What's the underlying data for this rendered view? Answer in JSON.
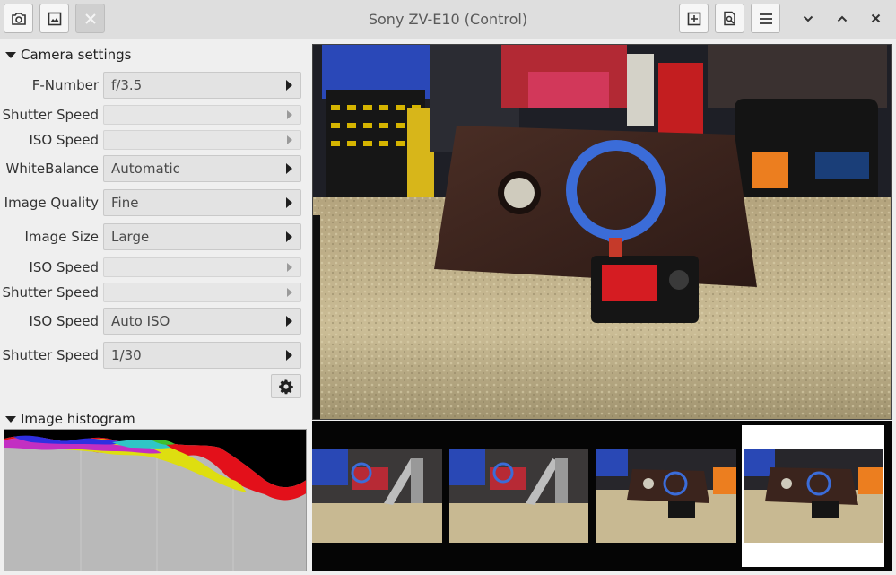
{
  "window": {
    "title": "Sony ZV-E10 (Control)",
    "toolbar_left": [
      {
        "icon": "camera-icon"
      },
      {
        "icon": "image-icon"
      },
      {
        "icon": "close-capture-icon",
        "disabled": true
      }
    ],
    "toolbar_right": [
      {
        "icon": "focus-target-icon"
      },
      {
        "icon": "zoom-document-icon"
      },
      {
        "icon": "hamburger-menu-icon"
      }
    ],
    "window_controls": [
      "minimize-icon",
      "maximize-icon",
      "close-icon"
    ]
  },
  "camera_settings": {
    "header": "Camera settings",
    "rows": [
      {
        "label": "F-Number",
        "value": "f/3.5",
        "enabled": true
      },
      {
        "label": "Shutter Speed",
        "value": "",
        "enabled": false
      },
      {
        "label": "ISO Speed",
        "value": "",
        "enabled": false
      },
      {
        "label": "WhiteBalance",
        "value": "Automatic",
        "enabled": true
      },
      {
        "label": "Image Quality",
        "value": "Fine",
        "enabled": true
      },
      {
        "label": "Image Size",
        "value": "Large",
        "enabled": true
      },
      {
        "label": "ISO Speed",
        "value": "",
        "enabled": false
      },
      {
        "label": "Shutter Speed",
        "value": "",
        "enabled": false
      },
      {
        "label": "ISO Speed",
        "value": "Auto ISO",
        "enabled": true
      },
      {
        "label": "Shutter Speed",
        "value": "1/30",
        "enabled": true
      }
    ],
    "settings_icon": "gear-icon"
  },
  "histogram": {
    "header": "Image histogram",
    "colors": {
      "red": "#e3101a",
      "green": "#3fbf2f",
      "blue": "#2f2fe0",
      "yellow": "#dede10",
      "magenta": "#c22fc2",
      "cyan": "#2fc6c6",
      "background": "#b9b9b9"
    }
  },
  "filmstrip": {
    "count": 4,
    "selected_index": 3
  }
}
